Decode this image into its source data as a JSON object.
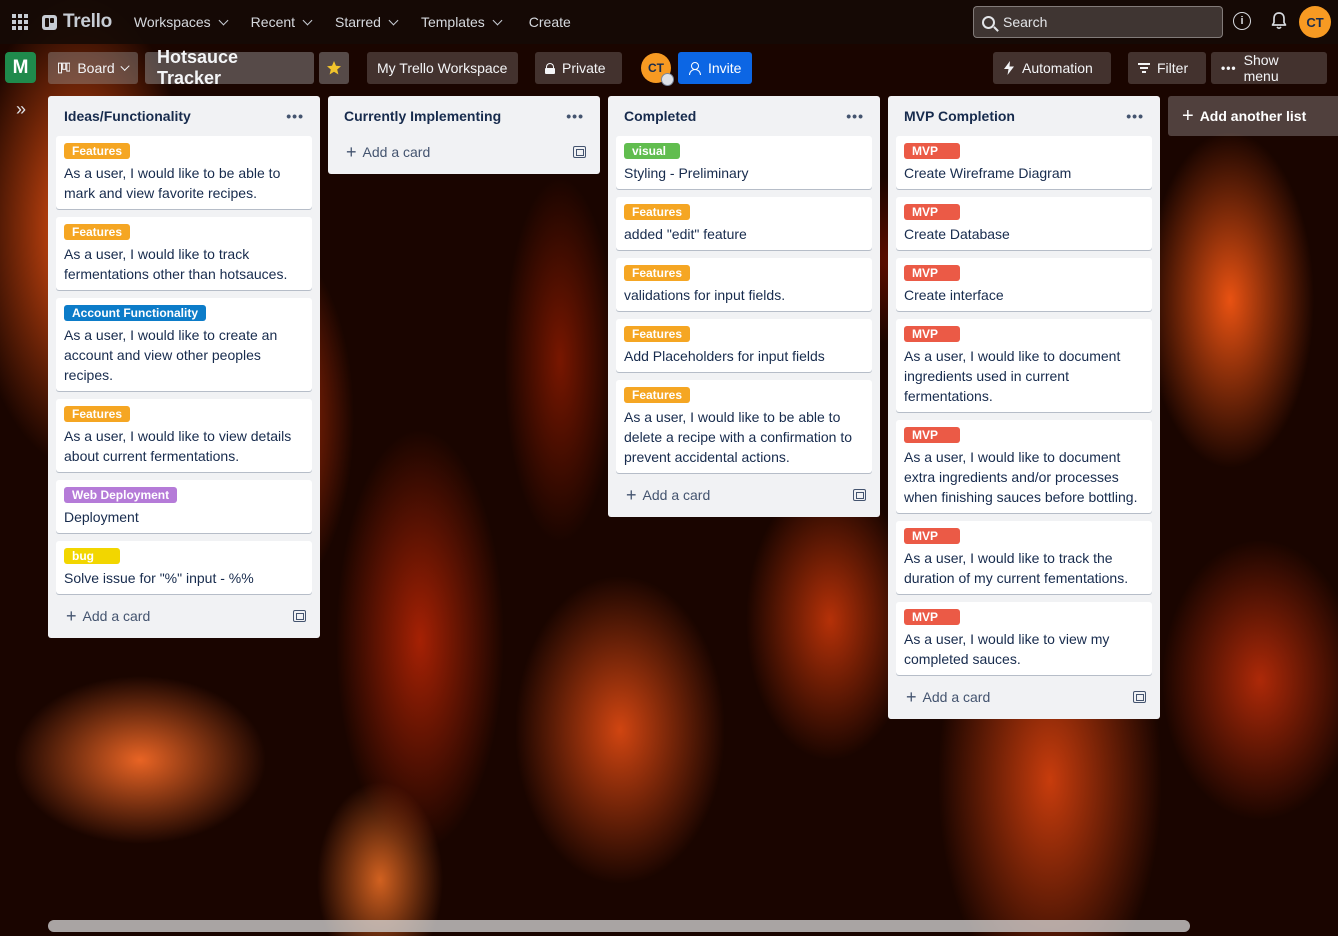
{
  "topbar": {
    "logo_text": "Trello",
    "nav": [
      "Workspaces",
      "Recent",
      "Starred",
      "Templates"
    ],
    "create_label": "Create",
    "search_placeholder": "Search",
    "info_glyph": "i",
    "avatar_initials": "CT"
  },
  "board": {
    "workspace_initial": "M",
    "view_label": "Board",
    "title": "Hotsauce Tracker",
    "workspace_label": "My Trello Workspace",
    "visibility_label": "Private",
    "member_initials": "CT",
    "invite_label": "Invite",
    "automation_label": "Automation",
    "filter_label": "Filter",
    "show_menu_label": "Show menu",
    "add_list_label": "Add another list"
  },
  "colors": {
    "accent": "#0c66e4",
    "features": "#f5a623",
    "account": "#0c7cc9",
    "web": "#b57bd8",
    "bug": "#f2d600",
    "visual": "#61bd4f",
    "mvp": "#eb5a46",
    "avatar": "#f79a22",
    "workspace_badge": "#1f8a4c"
  },
  "add_card_label": "Add a card",
  "lists": [
    {
      "title": "Ideas/Functionality",
      "cards": [
        {
          "label": "Features",
          "text": "As a user, I would like to be able to mark and view favorite recipes."
        },
        {
          "label": "Features",
          "text": "As a user, I would like to track fermentations other than hotsauces."
        },
        {
          "label": "Account Functionality",
          "text": "As a user, I would like to create an account and view other peoples recipes."
        },
        {
          "label": "Features",
          "text": "As a user, I would like to view details about current fermentations."
        },
        {
          "label": "Web Deployment",
          "text": "Deployment"
        },
        {
          "label": "bug",
          "text": "Solve issue for \"%\" input - %%"
        }
      ]
    },
    {
      "title": "Currently Implementing",
      "cards": []
    },
    {
      "title": "Completed",
      "cards": [
        {
          "label": "visual",
          "text": "Styling - Preliminary"
        },
        {
          "label": "Features",
          "text": "added \"edit\" feature"
        },
        {
          "label": "Features",
          "text": "validations for input fields."
        },
        {
          "label": "Features",
          "text": "Add Placeholders for input fields"
        },
        {
          "label": "Features",
          "text": "As a user, I would like to be able to delete a recipe with a confirmation to prevent accidental actions."
        }
      ]
    },
    {
      "title": "MVP Completion",
      "cards": [
        {
          "label": "MVP",
          "text": "Create Wireframe Diagram"
        },
        {
          "label": "MVP",
          "text": "Create Database"
        },
        {
          "label": "MVP",
          "text": "Create interface"
        },
        {
          "label": "MVP",
          "text": "As a user, I would like to document ingredients used in current fermentations."
        },
        {
          "label": "MVP",
          "text": "As a user, I would like to document extra ingredients and/or processes when finishing sauces before bottling."
        },
        {
          "label": "MVP",
          "text": "As a user, I would like to track the duration of my current fementations."
        },
        {
          "label": "MVP",
          "text": "As a user, I would like to view my completed sauces."
        }
      ]
    }
  ]
}
